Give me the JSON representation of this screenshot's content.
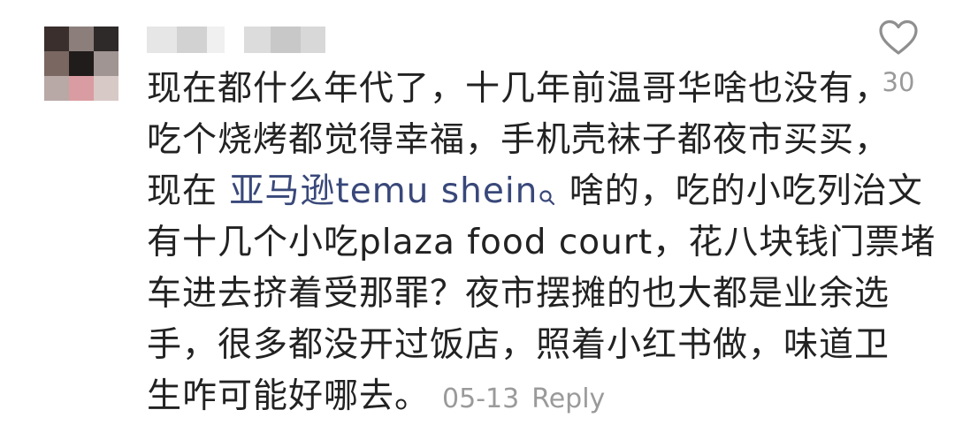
{
  "comment": {
    "lines": [
      "现在都什么年代了，十几年前温哥华啥也没有，",
      "吃个烧烤都觉得幸福，手机壳袜子都夜市买买，",
      "有十几个小吃plaza food court，花八块钱门票堵",
      "车进去挤着受那罪？夜市摆摊的也大都是业余选",
      "手，很多都没开过饭店，照着小红书做，味道卫",
      "生咋可能好哪去。"
    ],
    "line3_prefix": "现在 ",
    "line3_link": "亚马逊temu shein",
    "line3_suffix": " 啥的，吃的小吃列治文",
    "date": "05-13",
    "reply_label": "Reply"
  },
  "like": {
    "count": "30",
    "icon": "heart-outline-icon"
  },
  "colors": {
    "text": "#222222",
    "link": "#39487a",
    "meta": "#9a9a9a"
  }
}
